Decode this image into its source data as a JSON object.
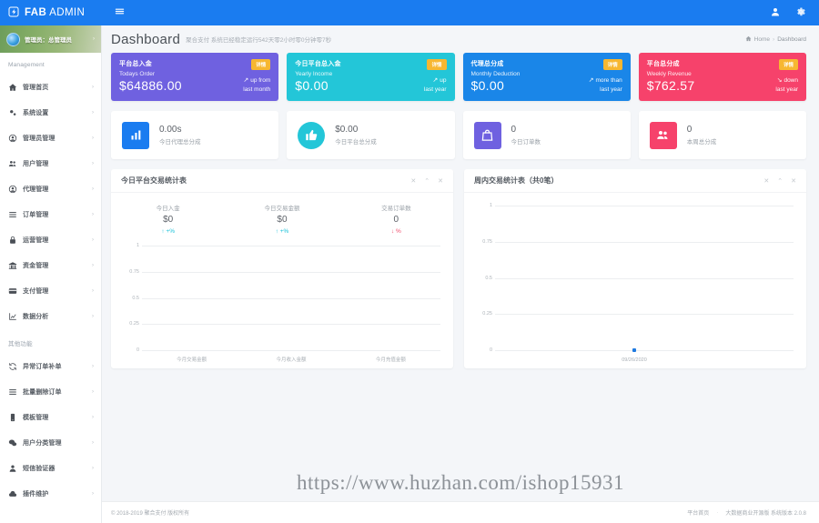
{
  "topbar": {
    "logo_icon": "lightning-logo-icon",
    "brand_bold": "FAB",
    "brand_light": "ADMIN",
    "menu_toggle_icon": "hamburger-icon",
    "user_icon": "user-circle-icon",
    "settings_icon": "gear-icon",
    "bg_color": "#1a7cf0"
  },
  "sidebar": {
    "user": {
      "name": "管理员：总管理员",
      "caret": "›"
    },
    "section_1_label": "Management",
    "section_2_label": "其他功能",
    "items_1": [
      {
        "label": "管理首页",
        "icon": "home-icon",
        "caret": "›"
      },
      {
        "label": "系统设置",
        "icon": "cogs-icon",
        "caret": "›"
      },
      {
        "label": "管理员管理",
        "icon": "user-circle-icon",
        "caret": "›"
      },
      {
        "label": "用户管理",
        "icon": "users-icon",
        "caret": "›"
      },
      {
        "label": "代理管理",
        "icon": "user-circle-icon",
        "caret": "›"
      },
      {
        "label": "订单管理",
        "icon": "list-icon",
        "caret": "›"
      },
      {
        "label": "运营管理",
        "icon": "lock-icon",
        "caret": "›"
      },
      {
        "label": "资金管理",
        "icon": "bank-icon",
        "caret": "›"
      },
      {
        "label": "支付管理",
        "icon": "card-icon",
        "caret": "›"
      },
      {
        "label": "数据分析",
        "icon": "chart-line-icon",
        "caret": "›"
      }
    ],
    "items_2": [
      {
        "label": "异常订单补单",
        "icon": "refresh-icon",
        "caret": "›"
      },
      {
        "label": "批量删除订单",
        "icon": "list-icon",
        "caret": "›"
      },
      {
        "label": "模板管理",
        "icon": "mobile-icon",
        "caret": "›"
      },
      {
        "label": "用户分类管理",
        "icon": "comments-icon",
        "caret": "›"
      },
      {
        "label": "短信验证器",
        "icon": "user-icon",
        "caret": "›"
      },
      {
        "label": "插件维护",
        "icon": "cloud-icon",
        "caret": "›"
      }
    ]
  },
  "page": {
    "title": "Dashboard",
    "subtitle": "聚合支付 系统已经稳定运行542天零2小时零0分钟零7秒",
    "breadcrumb": {
      "home_icon": "home-icon",
      "home": "Home",
      "separator": "›",
      "current": "Dashboard"
    }
  },
  "kpi_cards": [
    {
      "title": "平台总入金",
      "subtitle": "Todays Order",
      "value": "$64886.00",
      "badge": "详情",
      "trend_arrow": "↗",
      "trend_line1": "up from",
      "trend_line2": "last month",
      "color": "#6f61e0"
    },
    {
      "title": "今日平台总入金",
      "subtitle": "Yearly Income",
      "value": "$0.00",
      "badge": "详情",
      "trend_arrow": "↗",
      "trend_line1": "up",
      "trend_line2": "last year",
      "color": "#23c6d8"
    },
    {
      "title": "代理总分成",
      "subtitle": "Monthly Deduction",
      "value": "$0.00",
      "badge": "详情",
      "trend_arrow": "↗",
      "trend_line1": "more than",
      "trend_line2": "last year",
      "color": "#1a86e8"
    },
    {
      "title": "平台总分成",
      "subtitle": "Weekly Revenue",
      "value": "$762.57",
      "badge": "详情",
      "trend_arrow": "↘",
      "trend_line1": "down",
      "trend_line2": "last year",
      "color": "#f6426b"
    }
  ],
  "mini_stats": [
    {
      "value": "0.00s",
      "label": "今日代理总分成",
      "icon": "bar-chart-icon",
      "shape": "sq",
      "color": "#1a7cf0"
    },
    {
      "value": "$0.00",
      "label": "今日平台总分成",
      "icon": "thumbs-up-icon",
      "shape": "circ",
      "color": "#23c6d8"
    },
    {
      "value": "0",
      "label": "今日订单数",
      "icon": "bag-icon",
      "shape": "sq",
      "color": "#6f61e0"
    },
    {
      "value": "0",
      "label": "本周总分成",
      "icon": "users-icon",
      "shape": "sq",
      "color": "#f6426b"
    }
  ],
  "panel_left": {
    "title": "今日平台交易统计表",
    "tools": {
      "close": "✕",
      "collapse": "⌃",
      "remove": "✕"
    },
    "stats": [
      {
        "label": "今日入金",
        "value": "$0",
        "delta": "+%",
        "arrow": "↑",
        "dir": "up"
      },
      {
        "label": "今日交易金额",
        "value": "$0",
        "delta": "+%",
        "arrow": "↑",
        "dir": "up"
      },
      {
        "label": "交易订单数",
        "value": "0",
        "delta": "%",
        "arrow": "↓",
        "dir": "down"
      }
    ]
  },
  "panel_right": {
    "title": "周内交易统计表（共0笔）",
    "tools": {
      "close": "✕",
      "collapse": "⌃",
      "remove": "✕"
    }
  },
  "chart_data": [
    {
      "type": "bar",
      "title": "今日平台交易统计表",
      "categories": [
        "今月交易金额",
        "今月收入金额",
        "今月充值金额"
      ],
      "values": [
        0,
        0,
        0
      ],
      "yticks": [
        "1",
        "0.75",
        "0.5",
        "0.25",
        "0"
      ],
      "ylim": [
        0,
        1
      ],
      "xlabel": "",
      "ylabel": "",
      "grid": true,
      "legend": "none"
    },
    {
      "type": "line",
      "title": "周内交易统计表（共0笔）",
      "categories": [
        "09/26/2020"
      ],
      "values": [
        0
      ],
      "yticks": [
        "1",
        "0.75",
        "0.5",
        "0.25",
        "0"
      ],
      "ylim": [
        0,
        1
      ],
      "xlabel": "",
      "ylabel": "",
      "grid": true,
      "legend": "none",
      "point_color": "#1f7ae0"
    }
  ],
  "watermark": {
    "text": "https://www.huzhan.com/ishop15931"
  },
  "footer": {
    "left": "© 2018-2019 聚合支付 版权所有",
    "link": "平台首页",
    "separator": "·",
    "right": "大数据商业开源版 系统版本 2.0.8"
  }
}
